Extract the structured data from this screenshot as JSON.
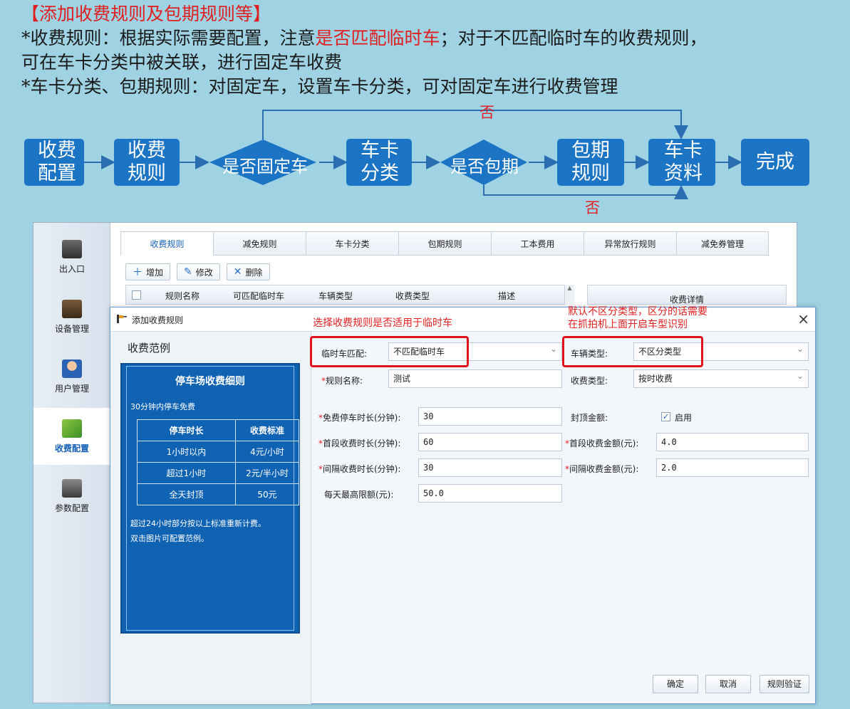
{
  "header": {
    "title": "【添加收费规则及包期规则等】",
    "line1_a": "*收费规则：根据实际需要配置，注意",
    "line1_red": "是否匹配临时车",
    "line1_b": "；对于不匹配临时车的收费规则，",
    "line2": "可在车卡分类中被关联，进行固定车收费",
    "line3": "*车卡分类、包期规则：对固定车，设置车卡分类，可对固定车进行收费管理"
  },
  "flow": {
    "box1_a": "收费",
    "box1_b": "配置",
    "box2_a": "收费",
    "box2_b": "规则",
    "dia1": "是否固定车",
    "box3_a": "车卡",
    "box3_b": "分类",
    "dia2": "是否包期",
    "box4_a": "包期",
    "box4_b": "规则",
    "box5_a": "车卡",
    "box5_b": "资料",
    "box6": "完成",
    "no_top": "否",
    "no_bottom": "否",
    "colors": {
      "box": "#1b75c4",
      "arrow": "#2a6db0"
    }
  },
  "sidebar": {
    "items": [
      {
        "label": "出入口",
        "icon": "camera-icon"
      },
      {
        "label": "设备管理",
        "icon": "device-icon"
      },
      {
        "label": "用户管理",
        "icon": "user-icon"
      },
      {
        "label": "收费配置",
        "icon": "money-icon"
      },
      {
        "label": "参数配置",
        "icon": "monitor-icon"
      }
    ]
  },
  "tabs": [
    "收费规则",
    "减免规则",
    "车卡分类",
    "包期规则",
    "工本费用",
    "异常放行规则",
    "减免券管理"
  ],
  "toolbar": {
    "add": "增加",
    "edit": "修改",
    "delete": "删除"
  },
  "grid": {
    "cols": [
      "规则名称",
      "可匹配临时车",
      "车辆类型",
      "收费类型",
      "描述"
    ],
    "detail": "收费详情"
  },
  "dialog": {
    "title": "添加收费规则",
    "example_title": "收费范例",
    "card": {
      "heading": "停车场收费细则",
      "sub": "30分钟内停车免费",
      "th_time": "停车时长",
      "th_fee": "收费标准",
      "rows": [
        {
          "time": "1小时以内",
          "fee": "4元/小时"
        },
        {
          "time": "超过1小时",
          "fee": "2元/半小时"
        },
        {
          "time": "全天封顶",
          "fee": "50元"
        }
      ],
      "note1": "超过24小时部分按以上标准重新计费。",
      "note2": "双击图片可配置范例。"
    },
    "form": {
      "temp_label": "临时车匹配:",
      "temp_value": "不匹配临时车",
      "vehicle_label": "车辆类型:",
      "vehicle_value": "不区分类型",
      "name_label": "规则名称:",
      "name_value": "测试",
      "feetype_label": "收费类型:",
      "feetype_value": "按时收费",
      "free_label": "免费停车时长(分钟):",
      "free_value": "30",
      "cap_label": "封顶金额:",
      "cap_check": "启用",
      "first_dur_label": "首段收费时长(分钟):",
      "first_dur_value": "60",
      "first_amt_label": "首段收费金额(元):",
      "first_amt_value": "4.0",
      "int_dur_label": "间隔收费时长(分钟):",
      "int_dur_value": "30",
      "int_amt_label": "间隔收费金额(元):",
      "int_amt_value": "2.0",
      "max_label": "每天最高限额(元):",
      "max_value": "50.0",
      "required_mark": "*"
    },
    "annot1": "选择收费规则是否适用于临时车",
    "annot2_a": "默认不区分类型，区分的话需要",
    "annot2_b": "在抓拍机上面开启车型识别",
    "buttons": {
      "ok": "确定",
      "cancel": "取消",
      "verify": "规则验证"
    },
    "close": "×"
  }
}
